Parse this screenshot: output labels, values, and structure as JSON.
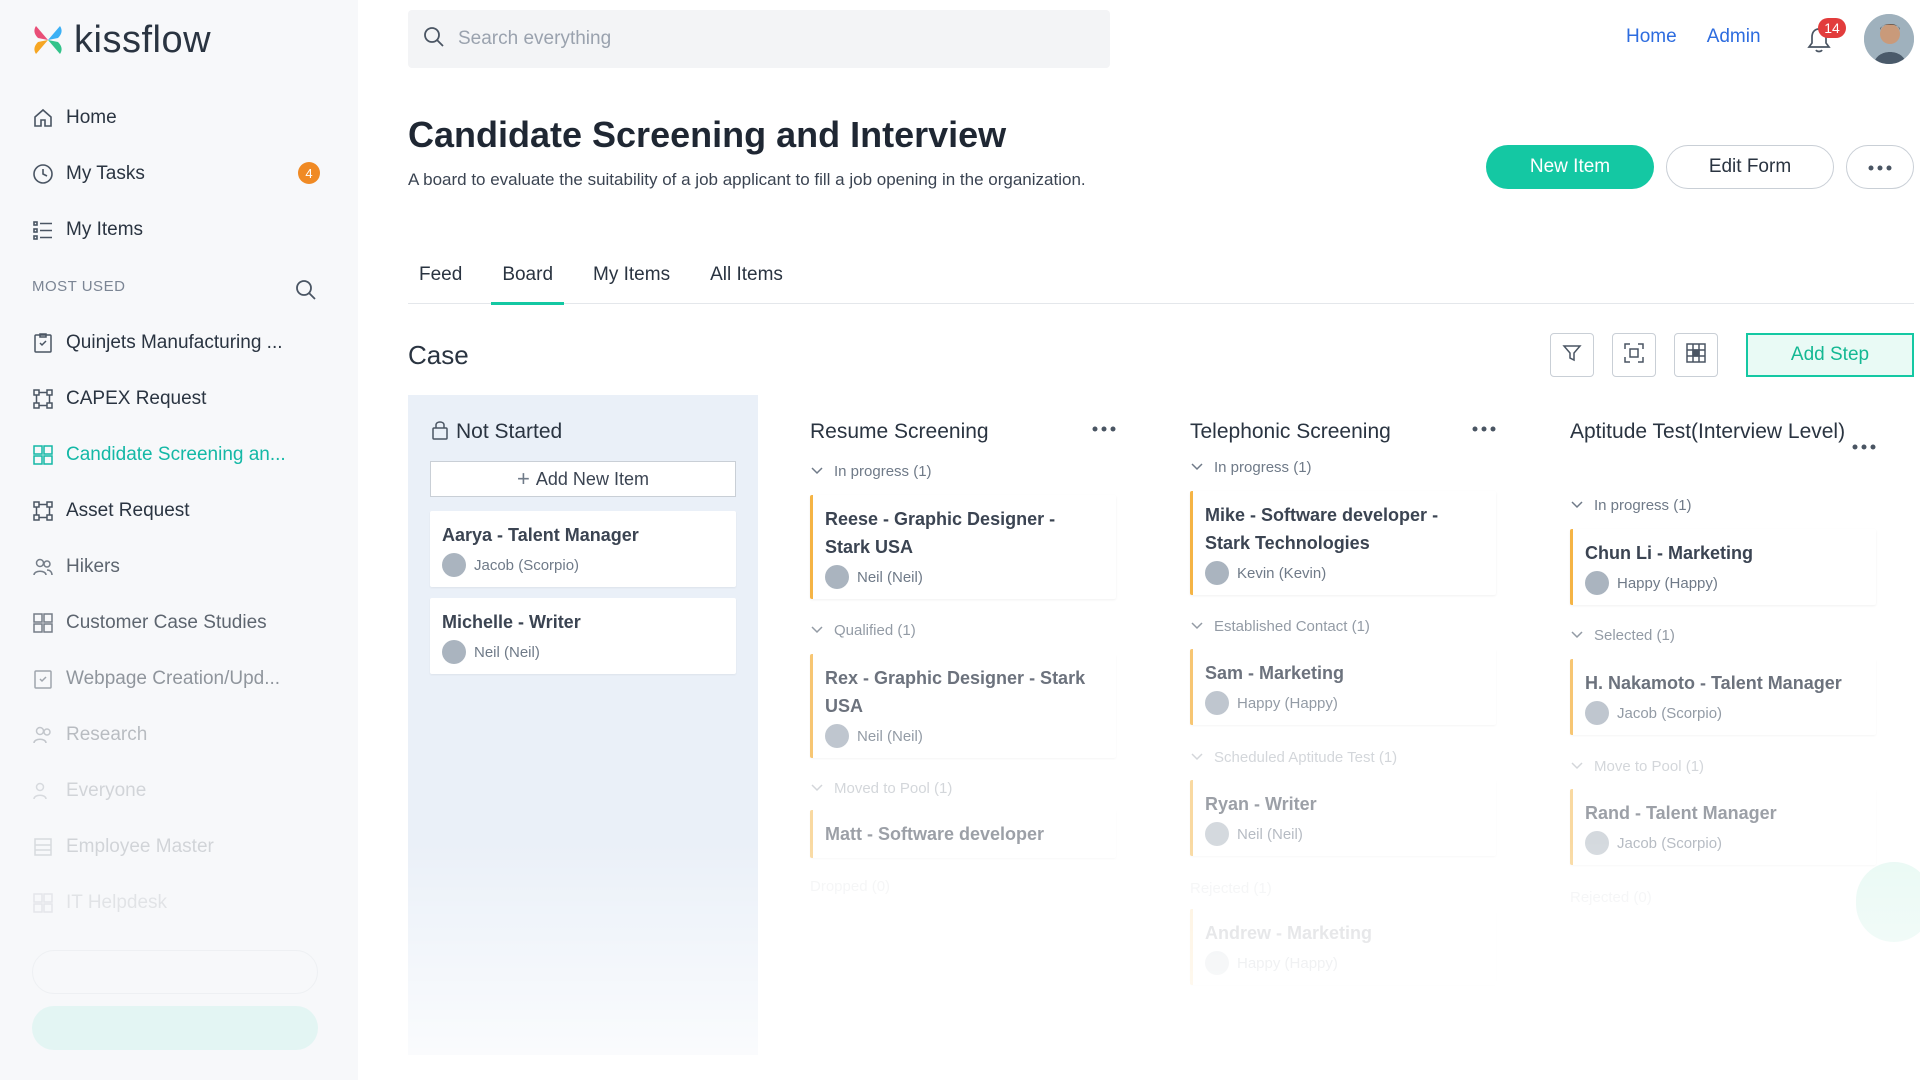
{
  "brand": {
    "name": "kissflow"
  },
  "sidebar": {
    "nav": [
      {
        "label": "Home",
        "icon": "home-icon"
      },
      {
        "label": "My Tasks",
        "icon": "clock-icon",
        "badge": "4"
      },
      {
        "label": "My Items",
        "icon": "list-icon"
      }
    ],
    "section_label": "MOST USED",
    "most_used": [
      {
        "label": "Quinjets Manufacturing ...",
        "icon": "form-icon"
      },
      {
        "label": "CAPEX Request",
        "icon": "workflow-icon"
      },
      {
        "label": "Candidate Screening an...",
        "icon": "board-icon",
        "active": true
      },
      {
        "label": "Asset Request",
        "icon": "workflow-icon"
      },
      {
        "label": "Hikers",
        "icon": "people-icon"
      },
      {
        "label": "Customer Case Studies",
        "icon": "board-icon"
      },
      {
        "label": "Webpage Creation/Upd...",
        "icon": "form-icon"
      },
      {
        "label": "Research",
        "icon": "people-icon"
      },
      {
        "label": "Everyone",
        "icon": "people-icon"
      },
      {
        "label": "Employee Master",
        "icon": "table-icon"
      },
      {
        "label": "IT Helpdesk",
        "icon": "board-icon"
      }
    ]
  },
  "topbar": {
    "search_placeholder": "Search everything",
    "links": [
      "Home",
      "Admin"
    ],
    "notification_count": "14"
  },
  "header": {
    "title": "Candidate Screening and Interview",
    "description": "A board to evaluate the suitability of a job applicant to fill a job opening in the organization.",
    "new_item_label": "New Item",
    "edit_form_label": "Edit Form"
  },
  "tabs": [
    {
      "label": "Feed"
    },
    {
      "label": "Board",
      "active": true
    },
    {
      "label": "My Items"
    },
    {
      "label": "All Items"
    }
  ],
  "board": {
    "title": "Case",
    "add_step_label": "Add Step",
    "columns": [
      {
        "title": "Not Started",
        "add_new_label": "Add New Item",
        "cards": [
          {
            "title": "Aarya - Talent Manager",
            "user": "Jacob (Scorpio)"
          },
          {
            "title": "Michelle - Writer",
            "user": "Neil (Neil)"
          }
        ]
      },
      {
        "title": "Resume Screening",
        "groups": [
          {
            "label": "In progress  (1)",
            "cards": [
              {
                "title": "Reese - Graphic Designer - Stark USA",
                "user": "Neil (Neil)"
              }
            ]
          },
          {
            "label": "Qualified  (1)",
            "cards": [
              {
                "title": "Rex - Graphic Designer - Stark USA",
                "user": "Neil (Neil)"
              }
            ]
          },
          {
            "label": "Moved to Pool  (1)",
            "cards": [
              {
                "title": "Matt - Software developer",
                "user": ""
              }
            ]
          },
          {
            "label": "Dropped  (0)",
            "cards": []
          }
        ]
      },
      {
        "title": "Telephonic Screening",
        "groups": [
          {
            "label": "In progress  (1)",
            "cards": [
              {
                "title": "Mike - Software developer - Stark Technologies",
                "user": "Kevin (Kevin)"
              }
            ]
          },
          {
            "label": "Established Contact  (1)",
            "cards": [
              {
                "title": "Sam - Marketing",
                "user": "Happy (Happy)"
              }
            ]
          },
          {
            "label": "Scheduled Aptitude Test  (1)",
            "cards": [
              {
                "title": "Ryan - Writer",
                "user": "Neil (Neil)"
              }
            ]
          },
          {
            "label": "Rejected  (1)",
            "cards": [
              {
                "title": "Andrew - Marketing",
                "user": "Happy (Happy)"
              }
            ]
          }
        ]
      },
      {
        "title": "Aptitude Test(Interview Level)",
        "groups": [
          {
            "label": "In progress  (1)",
            "cards": [
              {
                "title": "Chun Li - Marketing",
                "user": "Happy (Happy)"
              }
            ]
          },
          {
            "label": "Selected  (1)",
            "cards": [
              {
                "title": "H. Nakamoto - Talent Manager",
                "user": "Jacob (Scorpio)"
              }
            ]
          },
          {
            "label": "Move to Pool  (1)",
            "cards": [
              {
                "title": "Rand - Talent Manager",
                "user": "Jacob (Scorpio)"
              }
            ]
          },
          {
            "label": "Rejected  (0)",
            "cards": []
          }
        ]
      }
    ]
  },
  "colors": {
    "accent": "#14c8a3",
    "link": "#2d6cdf",
    "card_accent": "#f5b445",
    "badge": "#f08a24"
  }
}
